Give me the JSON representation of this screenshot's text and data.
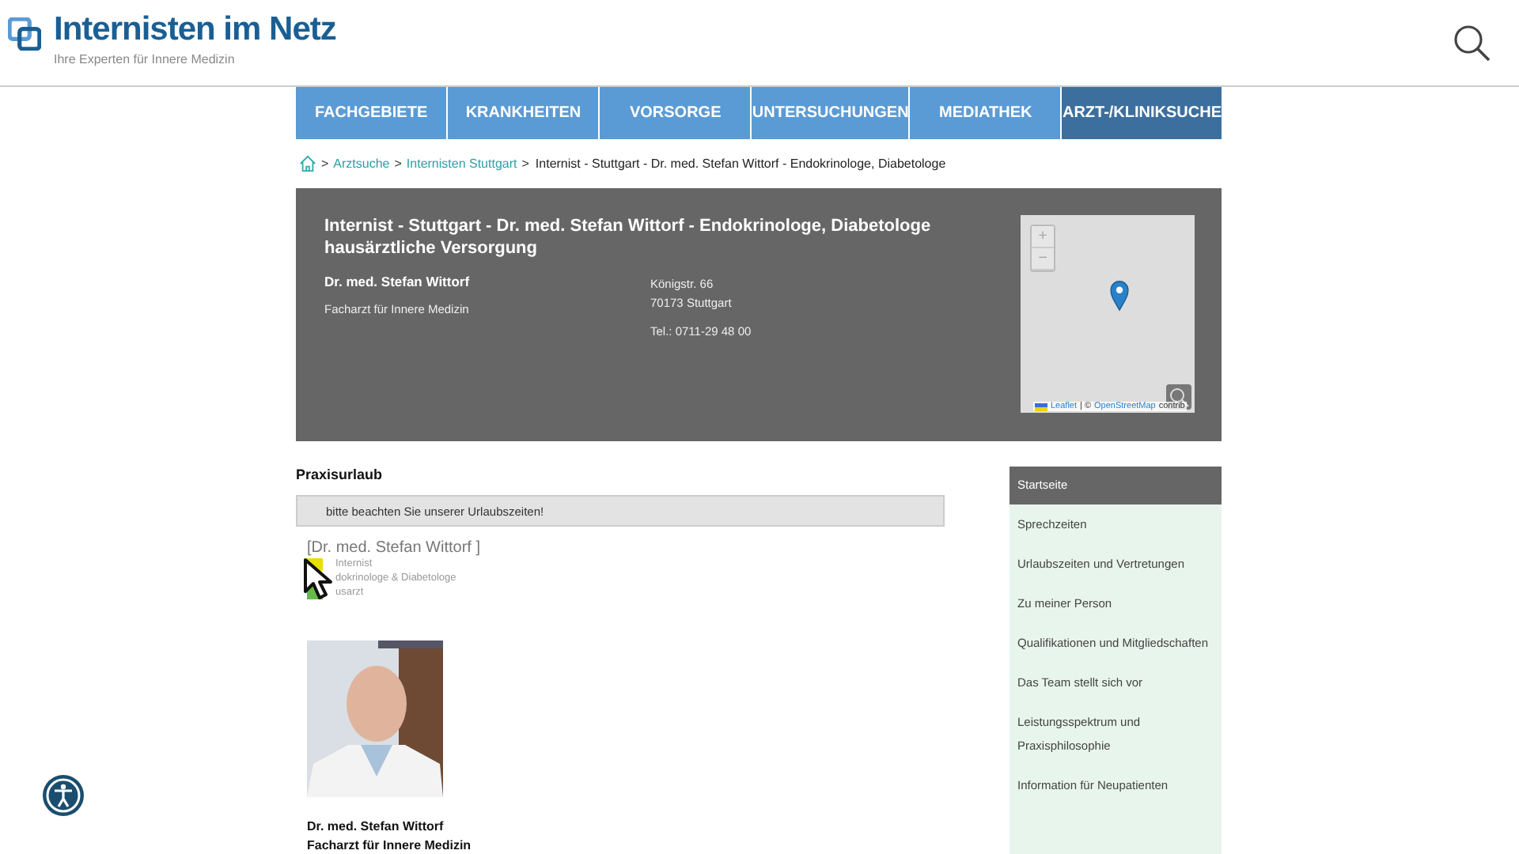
{
  "header": {
    "logo": "Internisten im Netz",
    "tagline": "Ihre Experten für Innere Medizin"
  },
  "nav": [
    {
      "label": "FACHGEBIETE",
      "selected": false
    },
    {
      "label": "KRANKHEITEN",
      "selected": false
    },
    {
      "label": "VORSORGE",
      "selected": false
    },
    {
      "label": "UNTERSUCHUNGEN",
      "selected": false
    },
    {
      "label": "MEDIATHEK",
      "selected": false
    },
    {
      "label": "ARZT-/KLINIKSUCHE",
      "selected": true
    }
  ],
  "breadcrumb": {
    "separator": ">",
    "links": [
      "Arztsuche",
      "Internisten Stuttgart"
    ],
    "current": "Internist - Stuttgart - Dr. med. Stefan Wittorf - Endokrinologe, Diabetologe"
  },
  "profile": {
    "title": "Internist - Stuttgart - Dr. med. Stefan Wittorf - Endokrinologe, Diabetologe hausärztliche Versorgung",
    "name": "Dr. med. Stefan Wittorf",
    "specialty": "Facharzt für Innere Medizin",
    "address": [
      "Königstr. 66",
      "70173 Stuttgart"
    ],
    "phone": "Tel.: 0711-29 48 00"
  },
  "map": {
    "zoom_in": "+",
    "zoom_out": "−",
    "attribution_link1": "Leaflet",
    "attribution_sep": "| ©",
    "attribution_link2": "OpenStreetMap",
    "attribution_tail": "contrib"
  },
  "notice": {
    "heading": "Praxisurlaub",
    "text": "bitte beachten Sie unserer Urlaubszeiten!"
  },
  "practice_logo": {
    "name": "[Dr. med. Stefan Wittorf ]",
    "lines": [
      {
        "text": "Internist",
        "color": "#e8e000"
      },
      {
        "text": "dokrinologe & Diabetologe"
      },
      {
        "text": "usarzt",
        "color": "#66bb44"
      }
    ]
  },
  "doctor": {
    "name": "Dr. med. Stefan Wittorf",
    "title": "Facharzt für Innere Medizin"
  },
  "sidebar": [
    {
      "label": "Startseite",
      "selected": true
    },
    {
      "label": "Sprechzeiten",
      "selected": false
    },
    {
      "label": "Urlaubszeiten und Vertretungen",
      "selected": false
    },
    {
      "label": "Zu meiner Person",
      "selected": false
    },
    {
      "label": "Qualifikationen und Mitgliedschaften",
      "selected": false
    },
    {
      "label": "Das Team stellt sich vor",
      "selected": false
    },
    {
      "label": "Leistungsspektrum und Praxisphilosophie",
      "selected": false
    },
    {
      "label": "Information für Neupatienten",
      "selected": false
    }
  ]
}
